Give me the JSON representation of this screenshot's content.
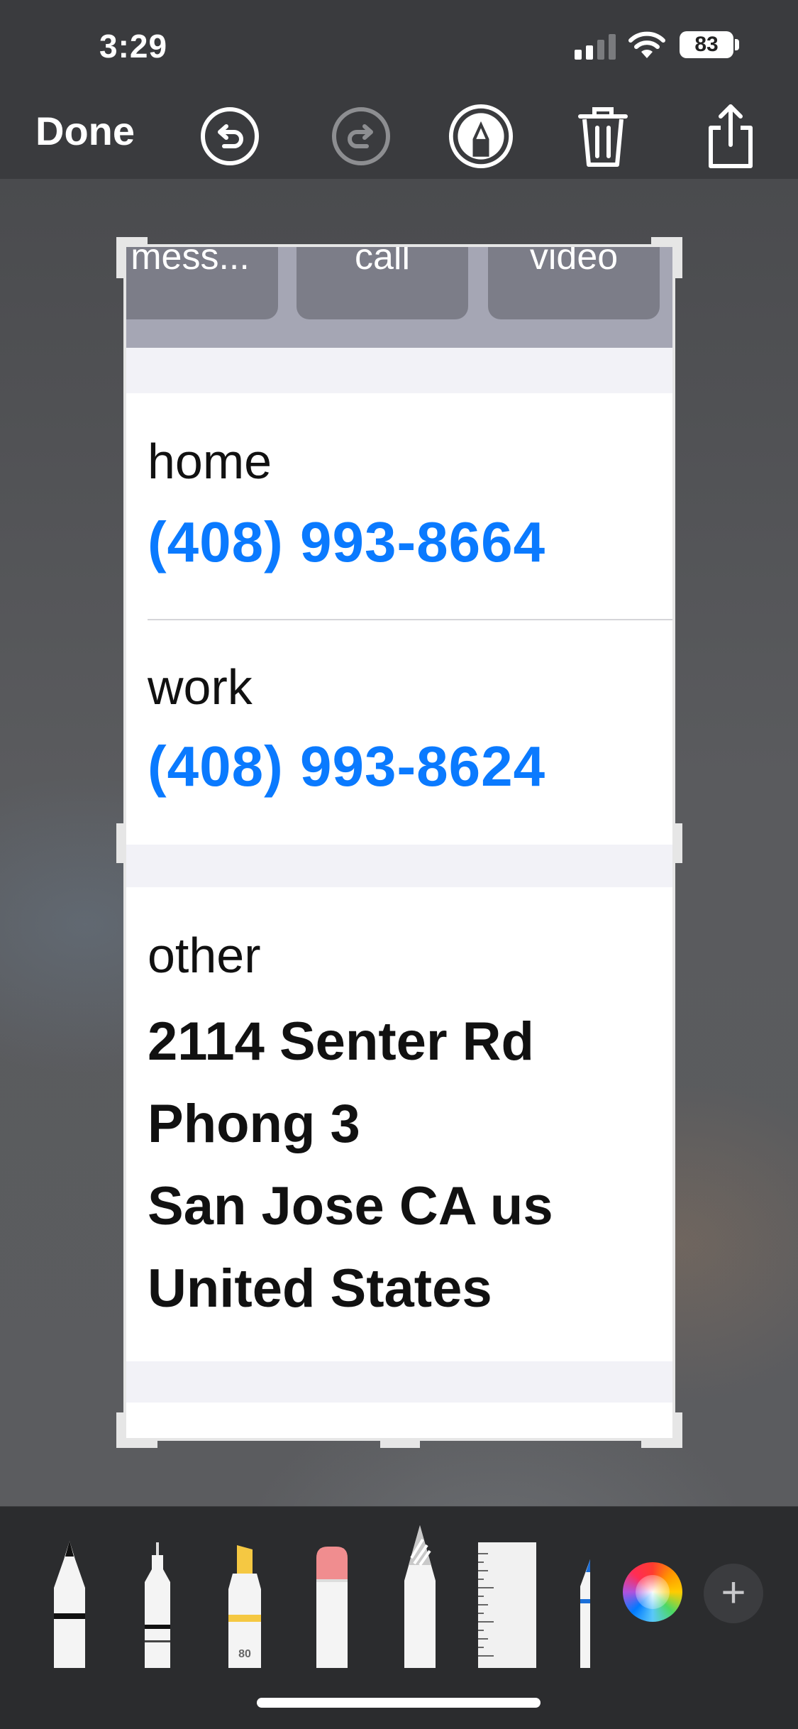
{
  "status_bar": {
    "time": "3:29",
    "battery": "83"
  },
  "toolbar": {
    "done_label": "Done",
    "icons": [
      "undo-icon",
      "redo-icon",
      "markup-pen-icon",
      "trash-icon",
      "share-icon"
    ]
  },
  "contact": {
    "quick_actions": [
      {
        "label": "mess..."
      },
      {
        "label": "call"
      },
      {
        "label": "video"
      }
    ],
    "phones": [
      {
        "label": "home",
        "number": "(408) 993-8664"
      },
      {
        "label": "work",
        "number": "(408) 993-8624"
      }
    ],
    "address": {
      "label": "other",
      "lines": [
        "2114 Senter Rd",
        "Phong 3",
        "San Jose CA us",
        "United States"
      ]
    }
  },
  "tools": {
    "items": [
      "pen-tool",
      "monoline-tool",
      "highlighter-tool",
      "eraser-tool",
      "lasso-tool",
      "ruler-tool",
      "pencil-tool"
    ],
    "highlighter_width": "80"
  },
  "colors": {
    "accent_blue": "#0a7aff",
    "highlighter_yellow": "#f5c842",
    "eraser_pink": "#f08d8f"
  }
}
